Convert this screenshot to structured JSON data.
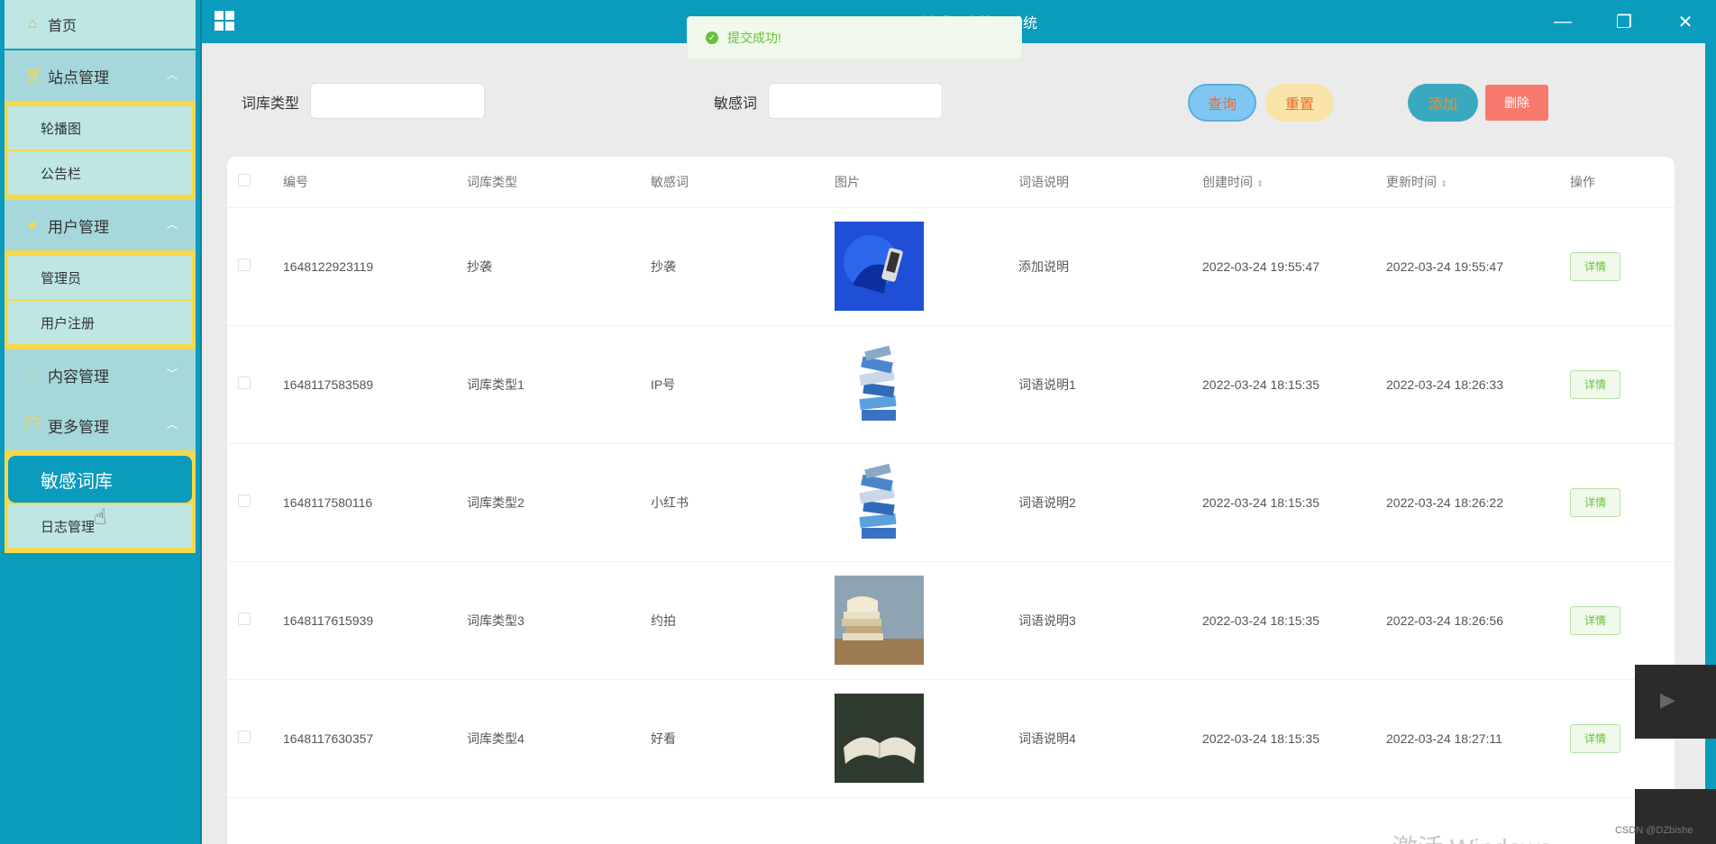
{
  "topbar": {
    "title": "敏感词库管理系统"
  },
  "toast": {
    "text": "提交成功!"
  },
  "sidebar": {
    "home": "首页",
    "groups": [
      {
        "label": "站点管理",
        "icon": "cart-icon",
        "items": [
          "轮播图",
          "公告栏"
        ]
      },
      {
        "label": "用户管理",
        "icon": "user-icon",
        "items": [
          "管理员",
          "用户注册"
        ]
      },
      {
        "label": "内容管理",
        "icon": "chat-icon",
        "items": []
      },
      {
        "label": "更多管理",
        "icon": "copy-icon",
        "items": [
          "敏感词库",
          "日志管理"
        ]
      }
    ],
    "active_item": "敏感词库"
  },
  "search": {
    "type_label": "词库类型",
    "word_label": "敏感词",
    "query_btn": "查询",
    "reset_btn": "重置",
    "add_btn": "添加",
    "delete_btn": "删除"
  },
  "table": {
    "headers": [
      "编号",
      "词库类型",
      "敏感词",
      "图片",
      "词语说明",
      "创建时间",
      "更新时间",
      "操作"
    ],
    "rows": [
      {
        "id": "1648122923119",
        "type": "抄袭",
        "word": "抄袭",
        "desc": "添加说明",
        "created": "2022-03-24 19:55:47",
        "updated": "2022-03-24 19:55:47",
        "action": "详情",
        "image": "blue-phone"
      },
      {
        "id": "1648117583589",
        "type": "词库类型1",
        "word": "IP号",
        "desc": "词语说明1",
        "created": "2022-03-24 18:15:35",
        "updated": "2022-03-24 18:26:33",
        "action": "详情",
        "image": "book-stack"
      },
      {
        "id": "1648117580116",
        "type": "词库类型2",
        "word": "小红书",
        "desc": "词语说明2",
        "created": "2022-03-24 18:15:35",
        "updated": "2022-03-24 18:26:22",
        "action": "详情",
        "image": "book-stack"
      },
      {
        "id": "1648117615939",
        "type": "词库类型3",
        "word": "约拍",
        "desc": "词语说明3",
        "created": "2022-03-24 18:15:35",
        "updated": "2022-03-24 18:26:56",
        "action": "详情",
        "image": "books-photo"
      },
      {
        "id": "1648117630357",
        "type": "词库类型4",
        "word": "好看",
        "desc": "词语说明4",
        "created": "2022-03-24 18:15:35",
        "updated": "2022-03-24 18:27:11",
        "action": "详情",
        "image": "open-book"
      }
    ]
  },
  "watermark": "激活 Windows",
  "credit": "CSDN @DZbishe"
}
